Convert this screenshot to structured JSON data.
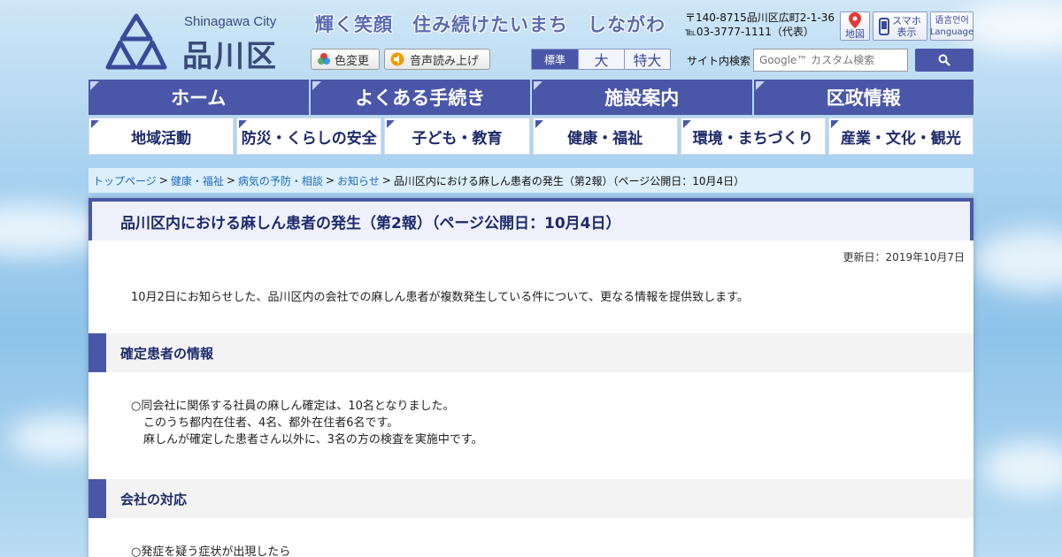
{
  "header": {
    "city_en": "Shinagawa City",
    "city_jp": "品川区",
    "slogan": "輝く笑顔　住み続けたいまち　しながわ",
    "color_change_label": "色変更",
    "read_aloud_label": "音声読み上げ",
    "font_sizes": [
      "標準",
      "大",
      "特大"
    ],
    "address_line1": "〒140-8715品川区広町2-1-36",
    "address_line2": "℡03-3777-1111（代表）",
    "map_label": "地図",
    "smartphone_label": "スマホ\n表示",
    "language_label": "语言언어\nLanguage",
    "search_label": "サイト内検索",
    "search_placeholder": "Google™ カスタム検索"
  },
  "main_nav": [
    "ホーム",
    "よくある手続き",
    "施設案内",
    "区政情報"
  ],
  "sub_nav": [
    "地域活動",
    "防災・くらしの安全",
    "子ども・教育",
    "健康・福祉",
    "環境・まちづくり",
    "産業・文化・観光"
  ],
  "breadcrumb": {
    "links": [
      "トップページ",
      "健康・福祉",
      "病気の予防・相談",
      "お知らせ"
    ],
    "current": "品川区内における麻しん患者の発生（第2報）（ページ公開日：10月4日）"
  },
  "content": {
    "title": "品川区内における麻しん患者の発生（第2報）（ページ公開日：10月4日）",
    "updated": "更新日：2019年10月7日",
    "intro": "10月2日にお知らせした、品川区内の会社での麻しん患者が複数発生している件について、更なる情報を提供致します。",
    "sections": [
      {
        "heading": "確定患者の情報",
        "lines": [
          "○同会社に関係する社員の麻しん確定は、10名となりました。",
          "このうち都内在住者、4名、都外在住者6名です。",
          "麻しんが確定した患者さん以外に、3名の方の検査を実施中です。"
        ]
      },
      {
        "heading": "会社の対応",
        "lines": [
          "○発症を疑う症状が出現したら"
        ]
      }
    ]
  },
  "colors": {
    "brand": "#4a57a8",
    "nav_text": "#1e2a6a",
    "link": "#1a6abf"
  }
}
